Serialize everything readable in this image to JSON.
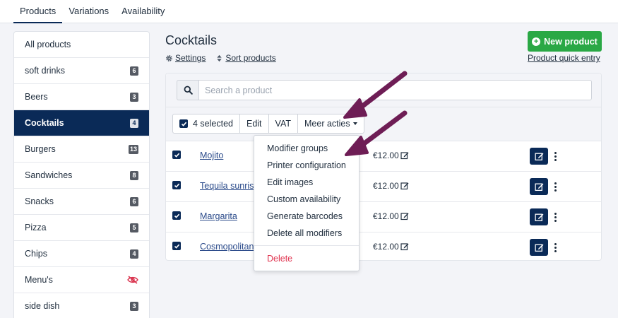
{
  "top_tabs": [
    {
      "label": "Products"
    },
    {
      "label": "Variations"
    },
    {
      "label": "Availability"
    }
  ],
  "sidebar": {
    "items": [
      {
        "label": "All products",
        "count": ""
      },
      {
        "label": "soft drinks",
        "count": "6"
      },
      {
        "label": "Beers",
        "count": "3"
      },
      {
        "label": "Cocktails",
        "count": "4"
      },
      {
        "label": "Burgers",
        "count": "13"
      },
      {
        "label": "Sandwiches",
        "count": "8"
      },
      {
        "label": "Snacks",
        "count": "6"
      },
      {
        "label": "Pizza",
        "count": "5"
      },
      {
        "label": "Chips",
        "count": "4"
      },
      {
        "label": "Menu's",
        "count": ""
      },
      {
        "label": "side dish",
        "count": "3"
      }
    ],
    "active": "Cocktails",
    "hidden_icon": "eye-slash-icon"
  },
  "header": {
    "title": "Cocktails",
    "settings_label": "Settings",
    "sort_label": "Sort products",
    "new_product_label": "New product",
    "quick_entry_label": "Product quick entry"
  },
  "search": {
    "placeholder": "Search a product",
    "value": ""
  },
  "toolbar": {
    "selected_label": "4 selected",
    "edit_label": "Edit",
    "vat_label": "VAT",
    "more_label": "Meer acties"
  },
  "products": [
    {
      "name": "Mojito",
      "price": "€12.00"
    },
    {
      "name": "Tequila sunrise",
      "price": "€12.00"
    },
    {
      "name": "Margarita",
      "price": "€12.00"
    },
    {
      "name": "Cosmopolitan",
      "price": "€12.00"
    }
  ],
  "dropdown": {
    "items": [
      "Modifier groups",
      "Printer configuration",
      "Edit images",
      "Custom availability",
      "Generate barcodes",
      "Delete all modifiers"
    ],
    "danger_item": "Delete"
  },
  "colors": {
    "navy": "#0a2a57",
    "green": "#2aa845",
    "danger": "#e0334f",
    "annotation_arrow": "#6e1d55"
  }
}
